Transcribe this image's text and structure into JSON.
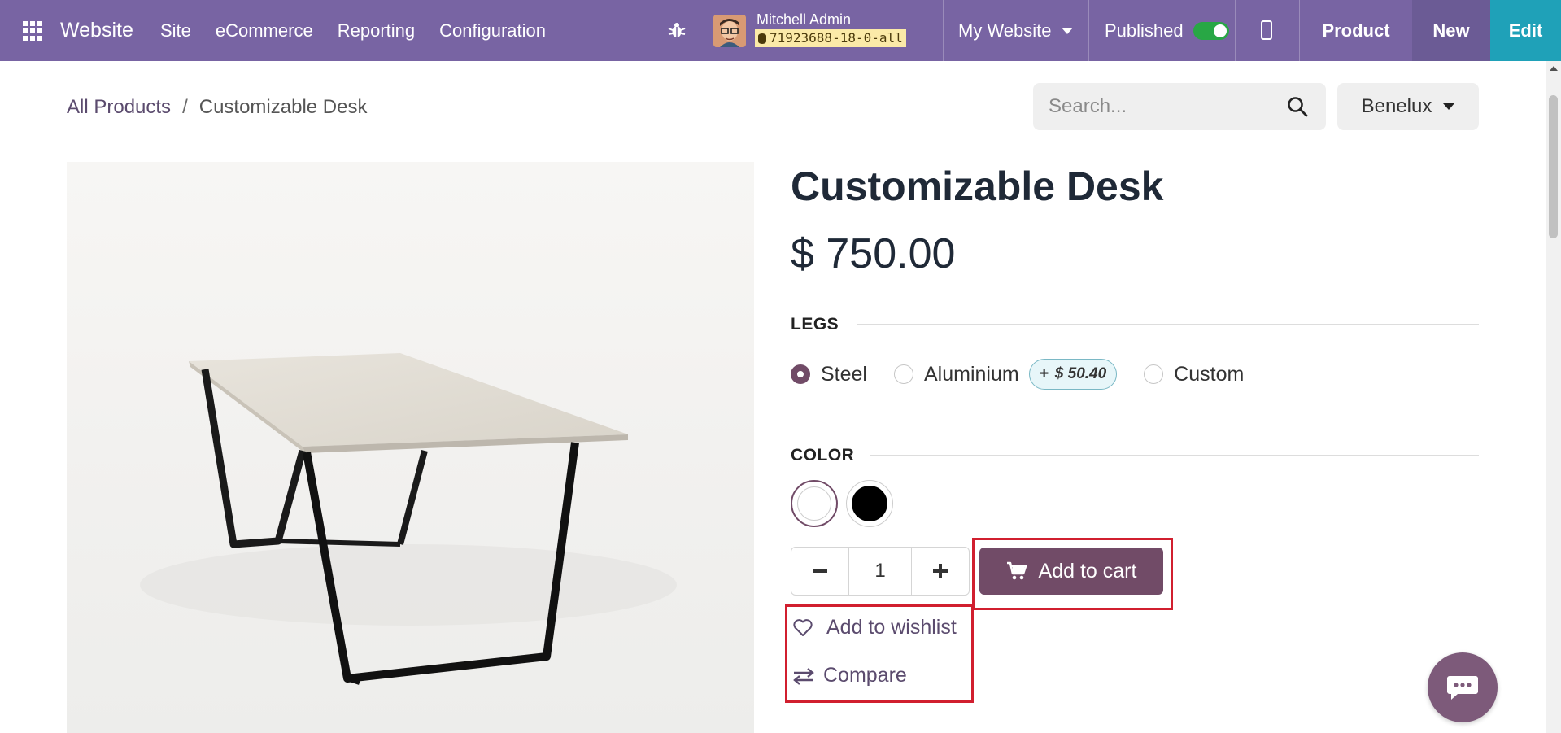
{
  "navbar": {
    "brand": "Website",
    "menu": [
      "Site",
      "eCommerce",
      "Reporting",
      "Configuration"
    ],
    "user_name": "Mitchell Admin",
    "db_name": "71923688-18-0-all",
    "website_selector": "My Website",
    "published_label": "Published",
    "published": true,
    "product_label": "Product",
    "new_label": "New",
    "edit_label": "Edit"
  },
  "breadcrumb": {
    "parent": "All Products",
    "separator": "/",
    "current": "Customizable Desk"
  },
  "search": {
    "placeholder": "Search..."
  },
  "pricelist": {
    "selected": "Benelux"
  },
  "product": {
    "name": "Customizable Desk",
    "price": "$ 750.00",
    "attributes": {
      "legs": {
        "label": "LEGS",
        "options": [
          {
            "label": "Steel",
            "selected": true
          },
          {
            "label": "Aluminium",
            "selected": false,
            "extra_sign": "+",
            "extra_price": "$ 50.40"
          },
          {
            "label": "Custom",
            "selected": false
          }
        ]
      },
      "color": {
        "label": "COLOR",
        "options": [
          {
            "name": "White",
            "hex": "#ffffff",
            "selected": true
          },
          {
            "name": "Black",
            "hex": "#000000",
            "selected": false
          }
        ]
      }
    },
    "quantity": "1",
    "add_to_cart": "Add to cart",
    "add_to_wishlist": "Add to wishlist",
    "compare": "Compare"
  },
  "icons": {
    "apps": "apps-grid-icon",
    "bug": "bug-icon",
    "search": "search-icon",
    "cart": "cart-icon",
    "heart": "heart-icon",
    "compare": "exchange-icon",
    "chat": "chat-icon",
    "mobile": "mobile-preview-icon"
  },
  "colors": {
    "navbar": "#7864a3",
    "primary": "#714b67",
    "edit": "#1fa1b8",
    "highlight": "#d11f2f"
  }
}
